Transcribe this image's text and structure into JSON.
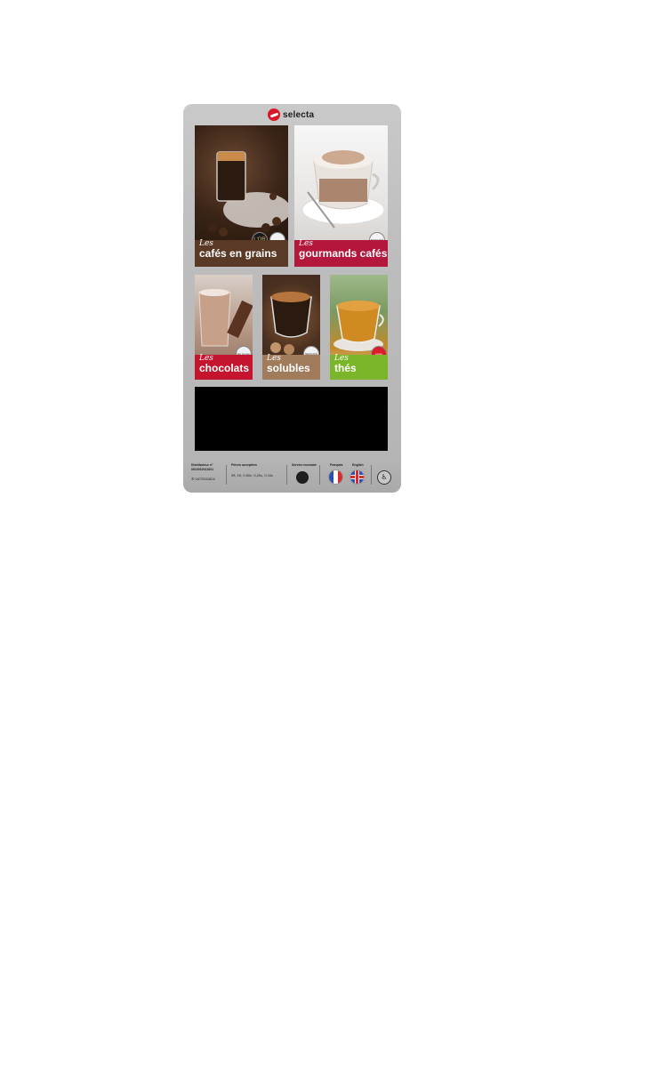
{
  "brand": {
    "name": "selecta",
    "accent": "#d7182a"
  },
  "tiles": [
    {
      "les": "Les",
      "name": "cafés en grains",
      "label_color": "#5a3a27",
      "badges": [
        "lor-icon",
        "certification-icon"
      ]
    },
    {
      "les": "Les",
      "name": "gourmands cafés",
      "label_color": "#b3173b",
      "badge": "NESCAFÉ"
    },
    {
      "les": "Les",
      "name": "chocolats",
      "label_color": "#c4142e",
      "badge": "Van Houten"
    },
    {
      "les": "Les",
      "name": "solubles",
      "label_color": "#a07c5c",
      "badge": "NESCAFÉ"
    },
    {
      "les": "Les",
      "name": "thés",
      "label_color": "#7bb52a",
      "badge": "Lipton"
    }
  ],
  "footer": {
    "distributor_label": "Distributeur n°",
    "distributor_number": "0010010011001",
    "phone": "0472541824",
    "coins_label": "Pièces acceptées",
    "coins_value": "2€, 1€, 0,50c, 0,20c, 0,10c",
    "sans_monnaie_label": "Service monnaie",
    "lang_fr": "Français",
    "lang_en": "English"
  }
}
